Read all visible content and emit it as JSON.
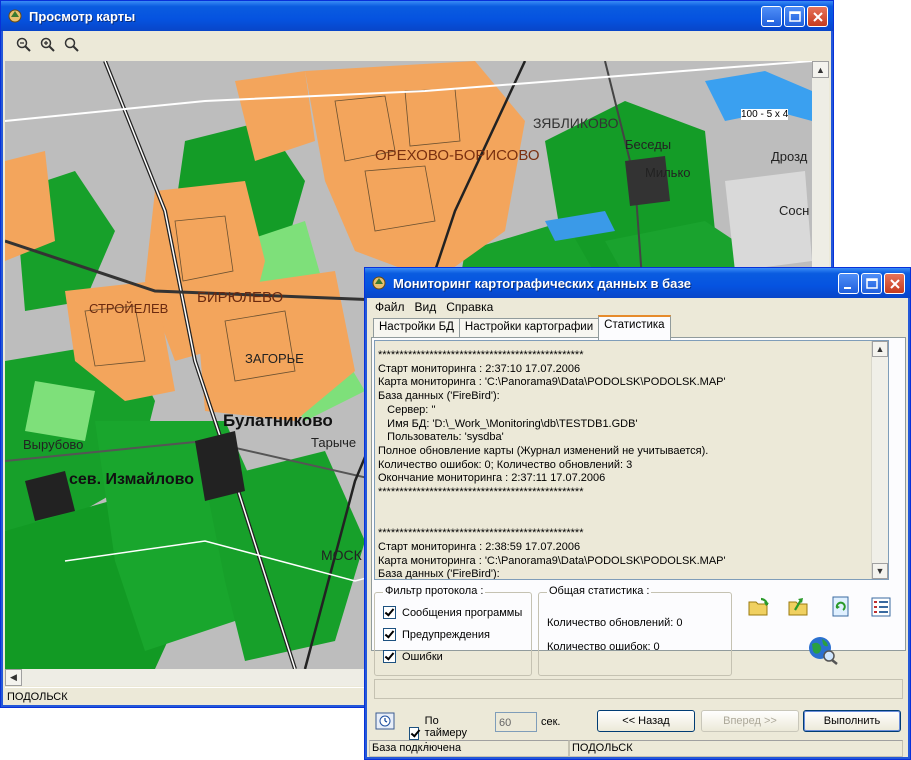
{
  "map_window": {
    "title": "Просмотр карты",
    "toolbar": {
      "zoom_buttons": [
        "zoom-out-icon",
        "zoom-in-icon",
        "zoom-reset-icon"
      ]
    },
    "map_labels": {
      "orekhovo": "ОРЕХОВО-БОРИСОВО",
      "zyablikovo": "ЗЯБЛИКОВО",
      "biryulevo": "БИРЮЛЕВО",
      "strojelev": "СТРОЙЕЛЕВ",
      "bulatnikovo": "Булатниково",
      "izmaylovo": "сев. Измайлово",
      "zagorye": "ЗАГОРЬЕ",
      "vyrubovo": "Вырубово",
      "besedy": "Беседы",
      "milkovo": "Милько",
      "drozd": "Дрозд",
      "sosny": "Сосн",
      "tarychevo": "Тарыче",
      "mosk": "МОСК",
      "scale_label": "100 - 5 x 4"
    },
    "status": "ПОДОЛЬСК"
  },
  "monitor_window": {
    "title": "Мониторинг картографических данных в базе",
    "menu": [
      "Файл",
      "Вид",
      "Справка"
    ],
    "tabs": [
      "Настройки БД",
      "Настройки картографии",
      "Статистика"
    ],
    "active_tab": "Статистика",
    "log": "************************************************\nСтарт мониторинга : 2:37:10 17.07.2006\nКарта мониторинга : 'C:\\Panorama9\\Data\\PODOLSK\\PODOLSK.MAP'\nБаза данных ('FireBird'):\n   Сервер: ''\n   Имя БД: 'D:\\_Work_\\Monitoring\\db\\TESTDB1.GDB'\n   Пользователь: 'sysdba'\nПолное обновление карты (Журнал изменений не учитывается).\nКоличество ошибок: 0; Количество обновлений: 3\nОкончание мониторинга : 2:37:11 17.07.2006\n************************************************\n\n\n************************************************\nСтарт мониторинга : 2:38:59 17.07.2006\nКарта мониторинга : 'C:\\Panorama9\\Data\\PODOLSK\\PODOLSK.MAP'\nБаза данных ('FireBird'):",
    "filter": {
      "legend": "Фильтр протокола :",
      "items": [
        "Сообщения программы",
        "Предупреждения",
        "Ошибки"
      ]
    },
    "stats": {
      "legend": "Общая статистика :",
      "updates": "Количество обновлений: 0",
      "errors": "Количество ошибок: 0"
    },
    "timer": {
      "label": "По таймеру :",
      "value": "60",
      "unit": "сек."
    },
    "buttons": {
      "back": "<< Назад",
      "next": "Вперед >>",
      "run": "Выполнить"
    },
    "status": {
      "connection": "База подключена",
      "map": "ПОДОЛЬСК"
    }
  }
}
